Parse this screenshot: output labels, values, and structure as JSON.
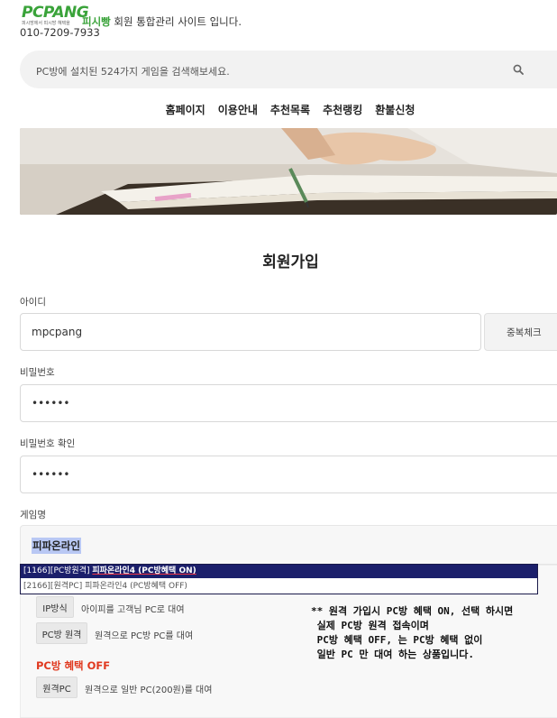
{
  "header": {
    "logo_text": "PCPANG",
    "logo_sub": "피시방에서 피시방 혜택을",
    "brand": "피시빵",
    "tagline_rest": " 회원 통합관리 사이트 입니다.",
    "phone": "010-7209-7933"
  },
  "search": {
    "placeholder": "PC방에 설치된 524가지 게임을 검색해보세요.",
    "icon": "search-icon"
  },
  "nav": [
    "홈페이지",
    "이용안내",
    "추천목록",
    "추천랭킹",
    "환불신청"
  ],
  "page_title": "회원가입",
  "form": {
    "id_label": "아이디",
    "id_value": "mpcpang",
    "dup_check": "중복체크",
    "pw_label": "비밀번호",
    "pw_value": "••••••",
    "pw_confirm_label": "비밀번호 확인",
    "pw_confirm_value": "••••••",
    "game_label": "게임명",
    "game_value": "피파온라인"
  },
  "dropdown": {
    "selected_prefix": "[1166][PC방원격] ",
    "selected_name": "피파온라인4 (PC방혜택 ON)",
    "option": "[2166][원격PC] 피파온라인4 (PC방혜택 OFF)"
  },
  "benefits_on": [
    {
      "tag": "IP방식",
      "desc": "아이피를 고객님 PC로 대여"
    },
    {
      "tag": "PC방 원격",
      "desc": "원격으로 PC방 PC를 대여"
    }
  ],
  "off_title": "PC방 혜택 OFF",
  "benefits_off": [
    {
      "tag": "원격PC",
      "desc": "원격으로 일반 PC(200원)를 대여"
    }
  ],
  "note": "** 원격 가입시 PC방 혜택 ON, 선택 하시면\n 실제 PC방 원격 접속이며\n PC방 혜택 OFF, 는 PC방 혜택 없이\n 일반 PC 만 대여 하는 상품입니다."
}
